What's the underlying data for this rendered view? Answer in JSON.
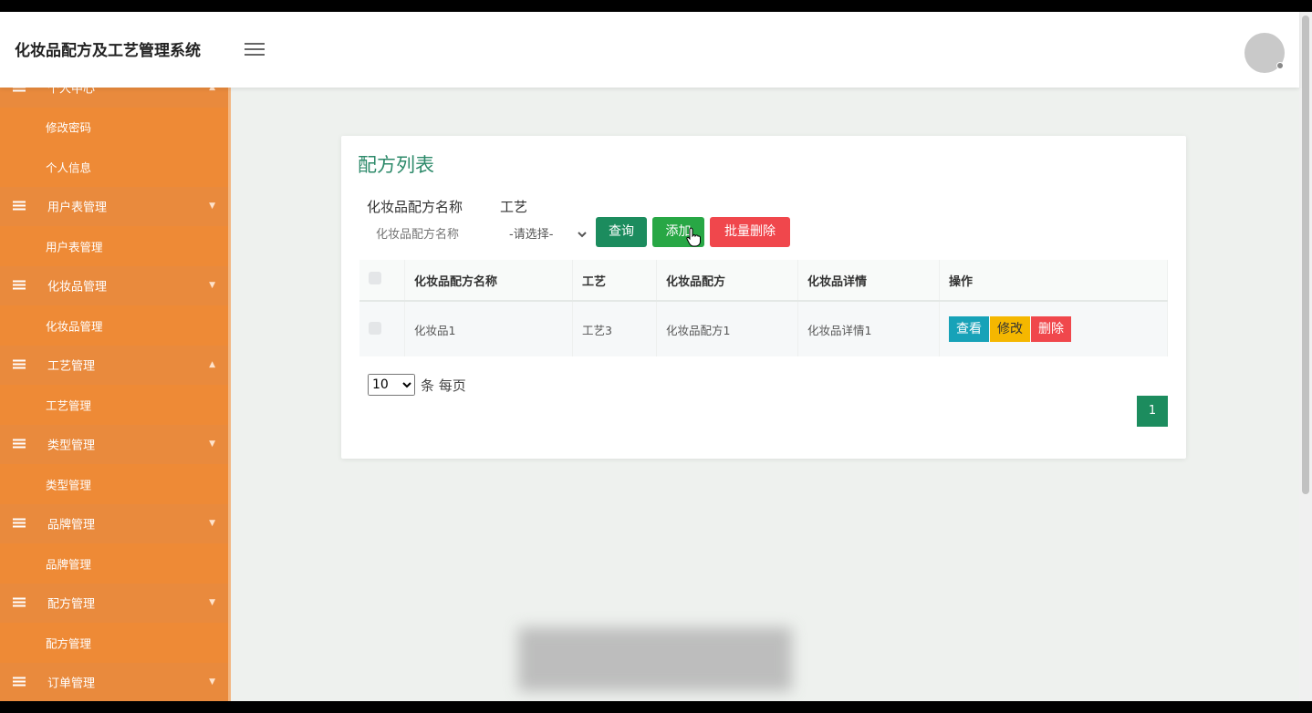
{
  "app": {
    "title": "化妆品配方及工艺管理系统"
  },
  "sidebar": {
    "items": [
      {
        "label": "个人中心",
        "type": "group",
        "arrow": "▲"
      },
      {
        "label": "修改密码",
        "type": "sub"
      },
      {
        "label": "个人信息",
        "type": "sub"
      },
      {
        "label": "用户表管理",
        "type": "group",
        "arrow": "▼"
      },
      {
        "label": "用户表管理",
        "type": "sub"
      },
      {
        "label": "化妆品管理",
        "type": "group",
        "arrow": "▼"
      },
      {
        "label": "化妆品管理",
        "type": "sub"
      },
      {
        "label": "工艺管理",
        "type": "group",
        "arrow": "▲"
      },
      {
        "label": "工艺管理",
        "type": "sub"
      },
      {
        "label": "类型管理",
        "type": "group",
        "arrow": "▼"
      },
      {
        "label": "类型管理",
        "type": "sub"
      },
      {
        "label": "品牌管理",
        "type": "group",
        "arrow": "▼"
      },
      {
        "label": "品牌管理",
        "type": "sub"
      },
      {
        "label": "配方管理",
        "type": "group",
        "arrow": "▼"
      },
      {
        "label": "配方管理",
        "type": "sub"
      },
      {
        "label": "订单管理",
        "type": "group",
        "arrow": "▼"
      }
    ]
  },
  "main": {
    "card_title": "配方列表",
    "search": {
      "name_label": "化妆品配方名称",
      "name_placeholder": "化妆品配方名称",
      "process_label": "工艺",
      "process_selected": "-请选择-",
      "query_label": "查询",
      "add_label": "添加",
      "batch_delete_label": "批量删除"
    },
    "table": {
      "headers": [
        "化妆品配方名称",
        "工艺",
        "化妆品配方",
        "化妆品详情",
        "操作"
      ],
      "rows": [
        {
          "name": "化妆品1",
          "process": "工艺3",
          "formula": "化妆品配方1",
          "detail": "化妆品详情1"
        }
      ],
      "actions": {
        "view": "查看",
        "edit": "修改",
        "delete": "删除"
      }
    },
    "pagination": {
      "page_size": "10",
      "page_size_label": "条 每页",
      "current_page": "1"
    }
  },
  "colors": {
    "sidebar": "#e8873a",
    "primary": "#1c8c5e",
    "danger": "#f0474c",
    "info": "#17a2b8",
    "warning": "#f5b700"
  }
}
